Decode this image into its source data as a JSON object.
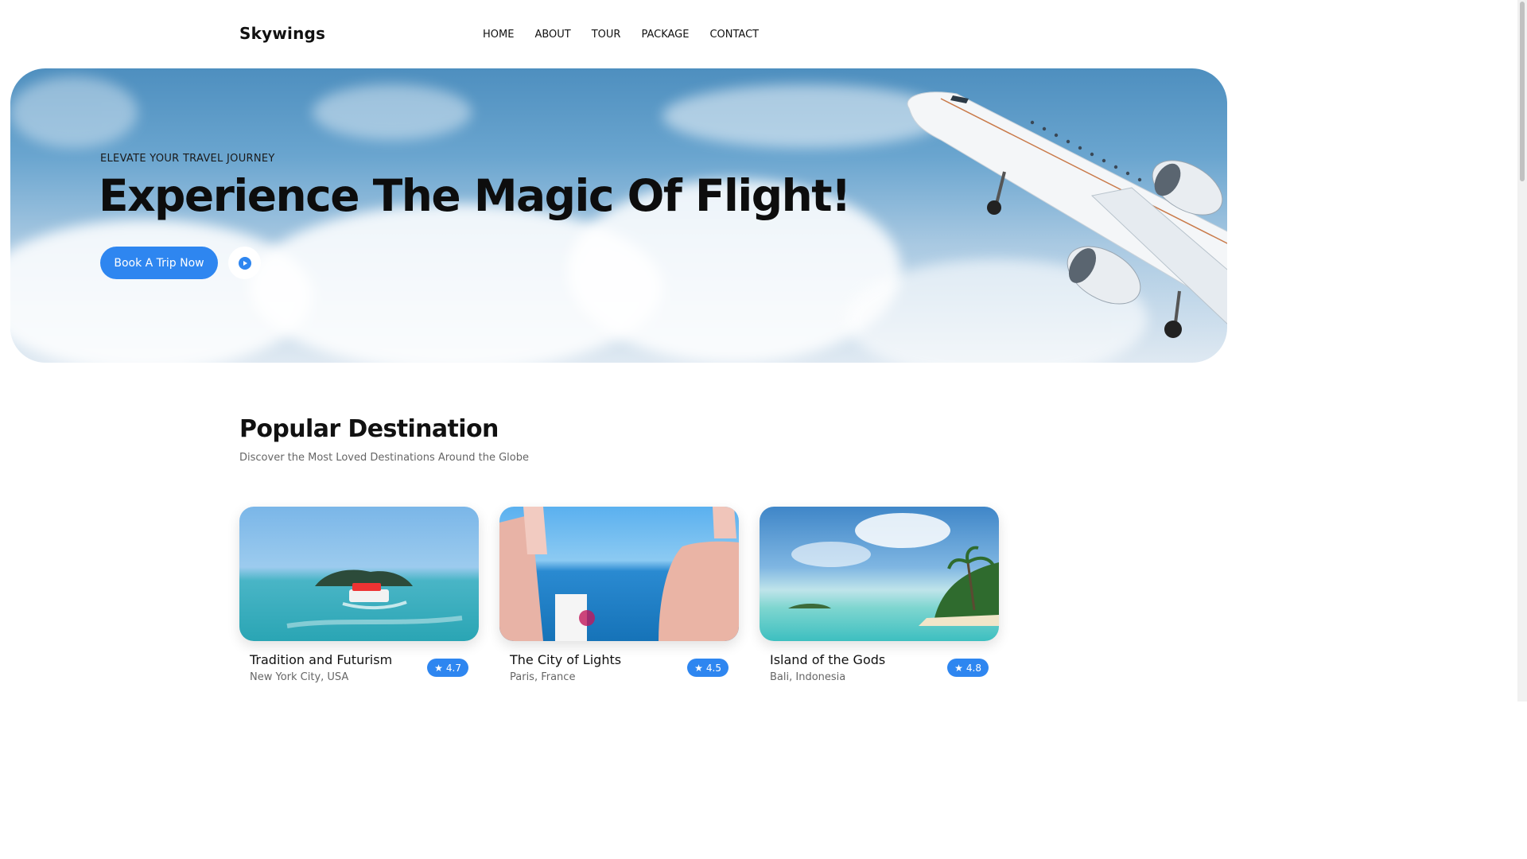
{
  "nav": {
    "brand": "Skywings",
    "links": [
      "HOME",
      "ABOUT",
      "TOUR",
      "PACKAGE",
      "CONTACT"
    ]
  },
  "hero": {
    "eyebrow": "ELEVATE YOUR TRAVEL JOURNEY",
    "title": "Experience The Magic Of Flight!",
    "cta_label": "Book A Trip Now",
    "play_icon": "play-icon"
  },
  "popular": {
    "title": "Popular Destination",
    "subtitle": "Discover the Most Loved Destinations Around the Globe",
    "cards": [
      {
        "title": "Tradition and Futurism",
        "location": "New York City, USA",
        "rating": "4.7"
      },
      {
        "title": "The City of Lights",
        "location": "Paris, France",
        "rating": "4.5"
      },
      {
        "title": "Island of the Gods",
        "location": "Bali, Indonesia",
        "rating": "4.8"
      }
    ]
  },
  "colors": {
    "accent": "#2e86f0",
    "text": "#111111",
    "muted": "#666666"
  }
}
